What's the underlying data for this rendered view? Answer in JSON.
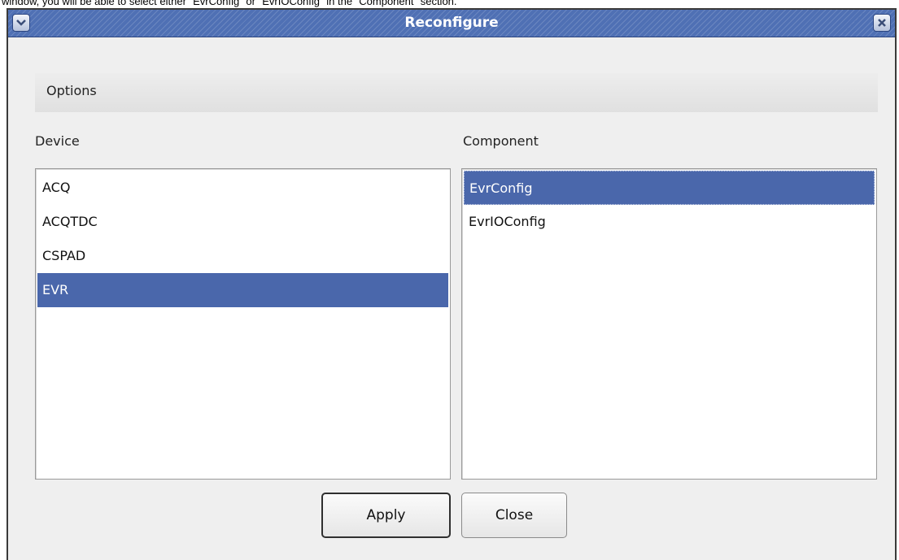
{
  "caption": "window, you will be able to select either \"EvrConfig\" or \"EvrIOConfig\" in the \"Component\" section.",
  "window": {
    "title": "Reconfigure",
    "menu_icon": "chevron-down-icon",
    "close_icon": "close-icon"
  },
  "options": {
    "label": "Options"
  },
  "device": {
    "label": "Device",
    "items": [
      "ACQ",
      "ACQTDC",
      "CSPAD",
      "EVR"
    ],
    "selected": "EVR"
  },
  "component": {
    "label": "Component",
    "items": [
      "EvrConfig",
      "EvrIOConfig"
    ],
    "selected": "EvrConfig"
  },
  "buttons": {
    "apply": "Apply",
    "close": "Close"
  },
  "colors": {
    "titlebar": "#4f70b4",
    "selection": "#4a67ab",
    "dialog_bg": "#efefef"
  }
}
